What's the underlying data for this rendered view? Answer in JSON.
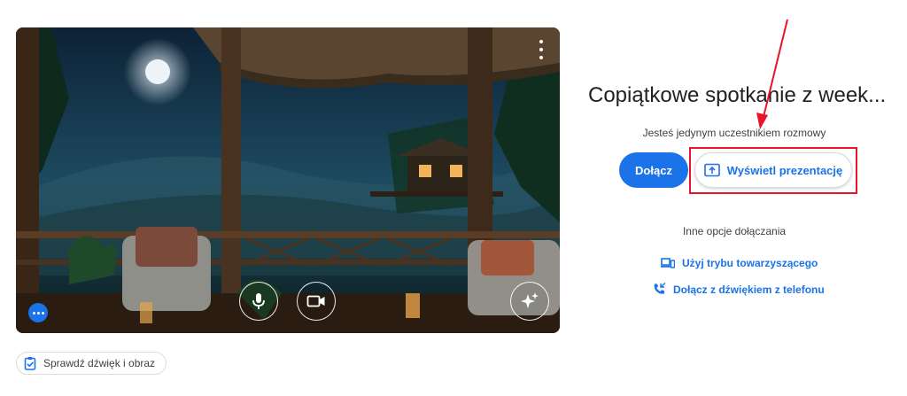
{
  "preview": {
    "more_icon": "more-vert-icon",
    "controls": {
      "mic_icon": "microphone-icon",
      "camera_icon": "video-camera-icon",
      "effects_icon": "sparkle-effects-icon",
      "options_icon": "more-horiz-icon"
    }
  },
  "check_button": {
    "label": "Sprawdź dźwięk i obraz",
    "icon": "clipboard-check-icon"
  },
  "meeting": {
    "title": "Copiątkowe spotkanie z week...",
    "status": "Jesteś jedynym uczestnikiem rozmowy"
  },
  "actions": {
    "join_label": "Dołącz",
    "present_label": "Wyświetl prezentację",
    "present_icon": "present-upload-icon"
  },
  "other_options": {
    "heading": "Inne opcje dołączania",
    "companion_label": "Użyj trybu towarzyszącego",
    "companion_icon": "devices-icon",
    "phone_label": "Dołącz z dźwiękiem z telefonu",
    "phone_icon": "phone-forwarded-icon"
  },
  "colors": {
    "accent": "#1a73e8",
    "annotation": "#e8132c"
  }
}
